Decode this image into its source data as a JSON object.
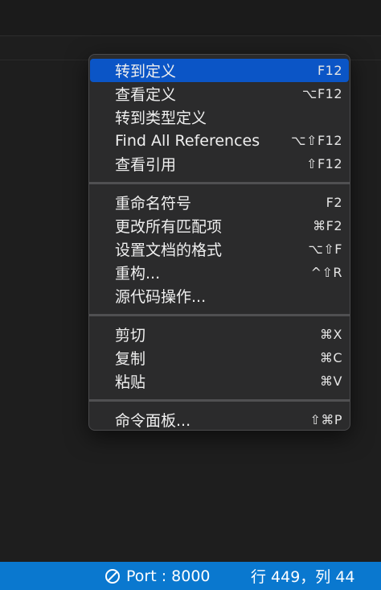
{
  "context_menu": {
    "groups": [
      [
        {
          "label": "转到定义",
          "shortcut": "F12",
          "selected": true
        },
        {
          "label": "查看定义",
          "shortcut": "⌥F12"
        },
        {
          "label": "转到类型定义",
          "shortcut": ""
        },
        {
          "label": "Find All References",
          "shortcut": "⌥⇧F12"
        },
        {
          "label": "查看引用",
          "shortcut": "⇧F12"
        }
      ],
      [
        {
          "label": "重命名符号",
          "shortcut": "F2"
        },
        {
          "label": "更改所有匹配项",
          "shortcut": "⌘F2"
        },
        {
          "label": "设置文档的格式",
          "shortcut": "⌥⇧F"
        },
        {
          "label": "重构...",
          "shortcut": "^⇧R"
        },
        {
          "label": "源代码操作...",
          "shortcut": ""
        }
      ],
      [
        {
          "label": "剪切",
          "shortcut": "⌘X"
        },
        {
          "label": "复制",
          "shortcut": "⌘C"
        },
        {
          "label": "粘贴",
          "shortcut": "⌘V"
        }
      ],
      [
        {
          "label": "命令面板...",
          "shortcut": "⇧⌘P"
        }
      ]
    ],
    "selected_color": "#0b55c6"
  },
  "status_bar": {
    "port_icon": "no-entry-icon",
    "port_text": "Port : 8000",
    "cursor_position": "行 449，列 44",
    "background_color": "#0a78cf"
  }
}
